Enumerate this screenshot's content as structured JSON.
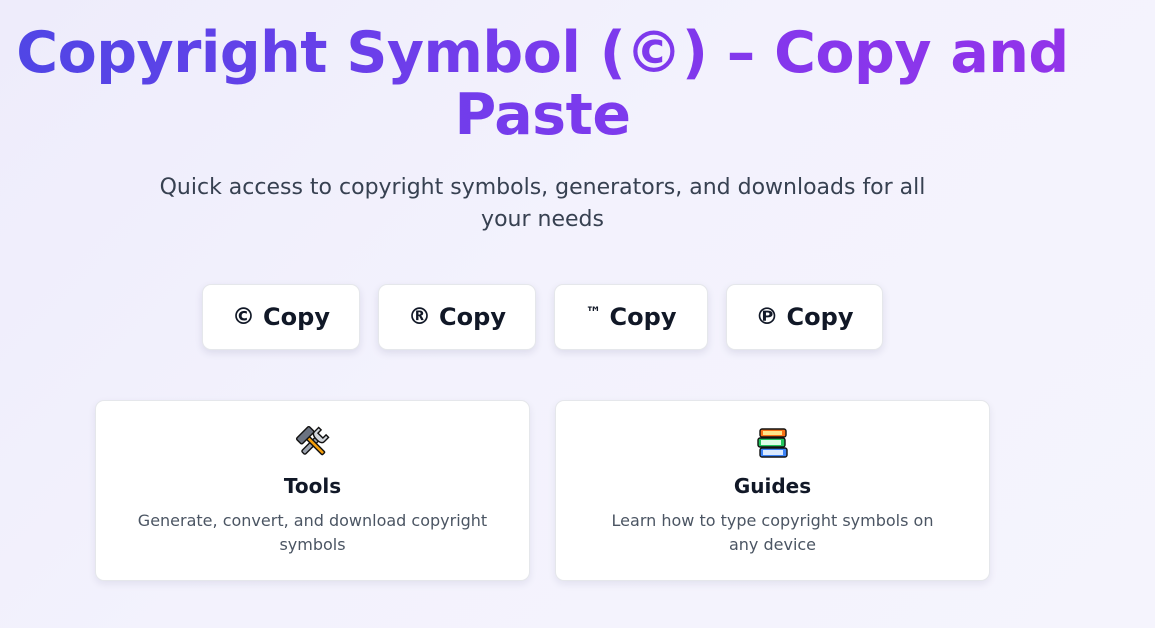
{
  "hero": {
    "title": "Copyright Symbol (©) – Copy and Paste",
    "subtitle": "Quick access to copyright symbols, generators, and downloads for all your needs"
  },
  "copy_buttons": [
    {
      "symbol": "©",
      "label": "Copy"
    },
    {
      "symbol": "®",
      "label": "Copy"
    },
    {
      "symbol": "™",
      "label": "Copy"
    },
    {
      "symbol": "℗",
      "label": "Copy"
    }
  ],
  "cards": [
    {
      "icon": "tools-icon",
      "title": "Tools",
      "description": "Generate, convert, and download copyright symbols"
    },
    {
      "icon": "books-icon",
      "title": "Guides",
      "description": "Learn how to type copyright symbols on any device"
    }
  ],
  "colors": {
    "title_gradient_start": "#4f46e5",
    "title_gradient_end": "#9333ea",
    "text_dark": "#111827",
    "text_muted": "#4b5563"
  }
}
